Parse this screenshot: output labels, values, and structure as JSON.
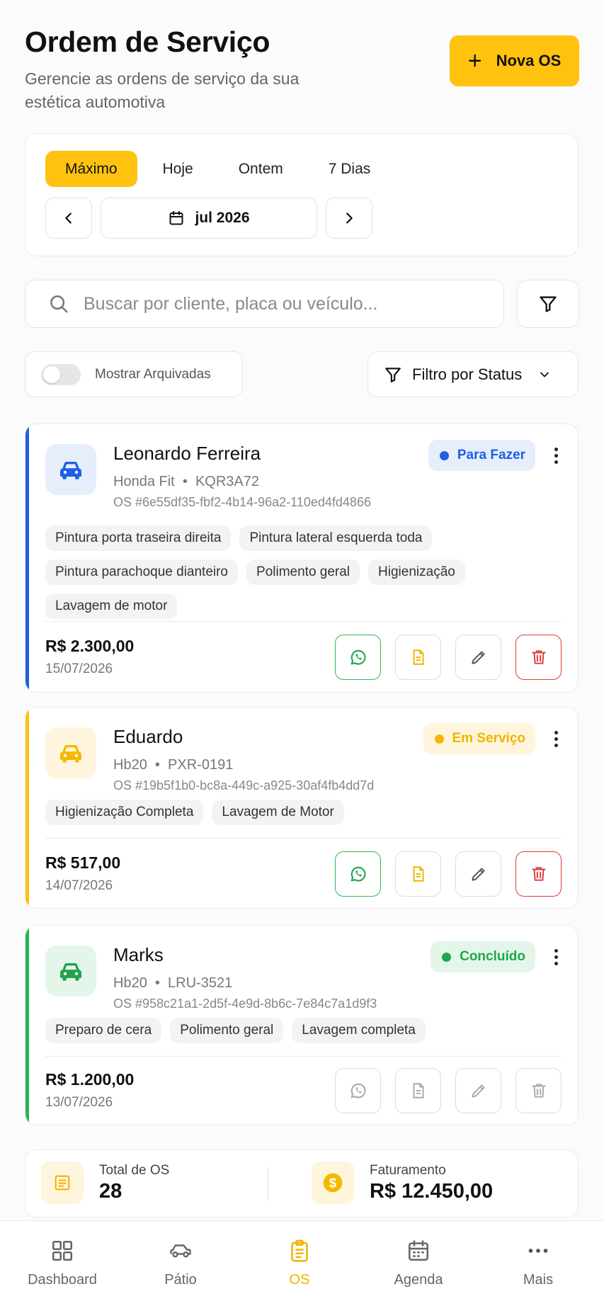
{
  "header": {
    "title": "Ordem de Serviço",
    "subtitle": "Gerencie as ordens de serviço da sua estética automotiva",
    "new_button": "Nova OS"
  },
  "period": {
    "tabs": [
      "Máximo",
      "Hoje",
      "Ontem",
      "7 Dias"
    ],
    "active_tab": "Máximo",
    "month": "jul 2026"
  },
  "search": {
    "placeholder": "Buscar por cliente, placa ou veículo..."
  },
  "filters": {
    "archived_label": "Mostrar Arquivadas",
    "archived_on": false,
    "status_label": "Filtro por Status"
  },
  "orders": [
    {
      "client": "Leonardo Ferreira",
      "vehicle": "Honda Fit",
      "plate": "KQR3A72",
      "os_id": "OS #6e55df35-fbf2-4b14-96a2-110ed4fd4866",
      "status": "Para Fazer",
      "status_color": "#1f5fe0",
      "status_bg": "#e6eefc",
      "icon_color": "#1f5fe0",
      "icon_bg": "#e6eefc",
      "services": [
        "Pintura porta traseira direita",
        "Pintura lateral esquerda toda",
        "Pintura parachoque dianteiro",
        "Polimento geral",
        "Higienização",
        "Lavagem de motor"
      ],
      "price": "R$ 2.300,00",
      "date": "15/07/2026",
      "actions_enabled": true
    },
    {
      "client": "Eduardo",
      "vehicle": "Hb20",
      "plate": "PXR-0191",
      "os_id": "OS #19b5f1b0-bc8a-449c-a925-30af4fb4dd7d",
      "status": "Em Serviço",
      "status_color": "#f0b400",
      "status_bg": "#fff5dc",
      "icon_color": "#f5b800",
      "icon_bg": "#fff5dc",
      "services": [
        "Higienização Completa",
        "Lavagem de Motor"
      ],
      "price": "R$ 517,00",
      "date": "14/07/2026",
      "actions_enabled": true
    },
    {
      "client": "Marks",
      "vehicle": "Hb20",
      "plate": "LRU-3521",
      "os_id": "OS #958c21a1-2d5f-4e9d-8b6c-7e84c7a1d9f3",
      "status": "Concluído",
      "status_color": "#1ea84a",
      "status_bg": "#e4f6ea",
      "icon_color": "#25a24b",
      "icon_bg": "#e4f6ea",
      "services": [
        "Preparo de cera",
        "Polimento geral",
        "Lavagem completa"
      ],
      "price": "R$ 1.200,00",
      "date": "13/07/2026",
      "actions_enabled": false
    }
  ],
  "summary": {
    "total_label": "Total de OS",
    "total_value": "28",
    "revenue_label": "Faturamento",
    "revenue_value": "R$ 12.450,00"
  },
  "nav": {
    "items": [
      "Dashboard",
      "Pátio",
      "OS",
      "Agenda",
      "Mais"
    ],
    "active": "OS"
  },
  "colors": {
    "accent": "#fec20f"
  }
}
